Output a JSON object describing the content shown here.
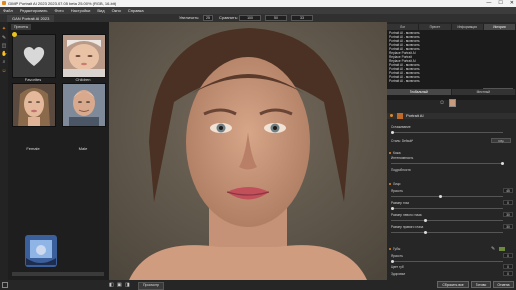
{
  "window": {
    "title": "GIMP Portrait AI 2023 2023.07.05 beta 25.00% (RGB, 16-bit)",
    "minimize": "—",
    "maximize": "☐",
    "close": "✕"
  },
  "menu": [
    "Файл",
    "Редактировать",
    "Фото",
    "Настройки",
    "Вид",
    "Окно",
    "Справка"
  ],
  "app_tab": "GAN Portrait AI 2023",
  "zoom": {
    "label": "Увеличить:",
    "value": "25",
    "compare_label": "Сравнить:",
    "values": [
      "100",
      "50",
      "33"
    ]
  },
  "presets": {
    "tab": "Пресеты",
    "items": [
      {
        "label": "Favorites"
      },
      {
        "label": "Children"
      },
      {
        "label": "Female"
      },
      {
        "label": "Male"
      }
    ]
  },
  "right_tabs": [
    {
      "label": "Лог",
      "active": false
    },
    {
      "label": "Пресет",
      "active": false
    },
    {
      "label": "Информация",
      "active": false
    },
    {
      "label": "История",
      "active": true
    }
  ],
  "history": [
    "Portrait AI - включить",
    "Portrait AI - включить",
    "Portrait AI - включить",
    "Portrait AI - включить",
    "Portrait AI - включить",
    "Replace Portrait AI",
    "Replace Portrait",
    "Replace Portrait AI",
    "Portrait AI - включить",
    "Portrait AI - включить",
    "Portrait AI - включить",
    "Portrait AI - включить",
    "Portrait AI - включить"
  ],
  "history_button": "Исходный вид",
  "view_tabs": [
    "Глобальный",
    "Местный"
  ],
  "plugin": {
    "name": "Portrait AI"
  },
  "global": {
    "label": "Сглаживание",
    "style_label": "Стиль: Default*",
    "style_button": "Сбр",
    "value": 0
  },
  "skin": {
    "title": "Кожа",
    "smooth_label": "Интенсивность",
    "detail_label": "Подробности",
    "smooth_value": 0
  },
  "faces": {
    "title": "Лицо",
    "rows": [
      {
        "label": "Яркость",
        "value": 45
      },
      {
        "label": "Размер глаз",
        "value": 0
      },
      {
        "label": "Размер левого глаза",
        "value": 30
      },
      {
        "label": "Размер правого глаза",
        "value": 30
      }
    ]
  },
  "lips": {
    "title": "Губы",
    "rows": [
      {
        "label": "Яркость",
        "value": 0
      },
      {
        "label": "Цвет губ",
        "value": 0
      },
      {
        "label": "Здоровье",
        "value": 0
      }
    ]
  },
  "bottom": {
    "preview": "Просмотр"
  },
  "actions": {
    "reset": "Сбросить все",
    "ok": "Готово",
    "cancel": "Отмена"
  },
  "colors": {
    "accent": "#e08a1e",
    "panel": "#262626",
    "background": "#2b2b2b"
  }
}
